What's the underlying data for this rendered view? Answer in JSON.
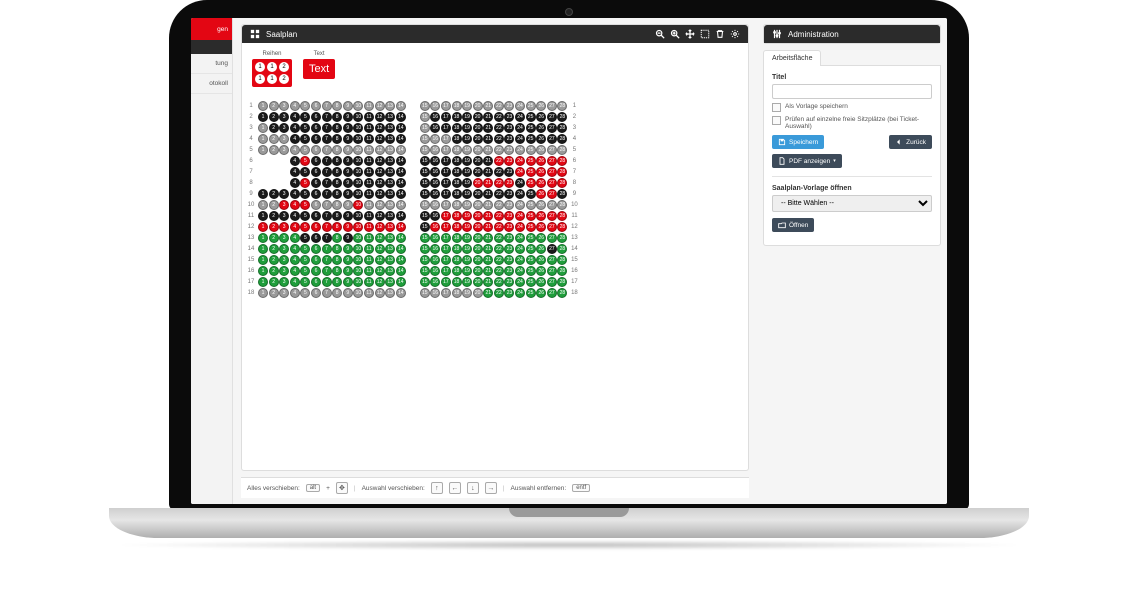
{
  "sidebar": {
    "top_red_fragment": "gen",
    "items": [
      "tung",
      "otokoll"
    ]
  },
  "main_panel": {
    "title": "Saalplan",
    "tools": [
      "zoom-out-icon",
      "zoom-in-icon",
      "move-icon",
      "select-icon",
      "delete-icon",
      "settings-icon"
    ]
  },
  "legend": {
    "reihen_label": "Reihen",
    "reihen_seats": [
      [
        1,
        1,
        2
      ],
      [
        1,
        1,
        2
      ]
    ],
    "text_label": "Text",
    "text_value": "Text"
  },
  "seating": {
    "rows": [
      {
        "n": 1,
        "left": "dddddddddddddd",
        "right": "dddddddddddddd"
      },
      {
        "n": 2,
        "left": "bbbbbbbbbbbbbb",
        "right": "dbbbbbbbbbbbbb"
      },
      {
        "n": 3,
        "left": "dbbbbbbbbbbbbb",
        "right": "dbbbbbbbbbbbbb"
      },
      {
        "n": 4,
        "left": "dddbbbbbbbbbbb",
        "right": "dddbbbbbbbbbbb"
      },
      {
        "n": 5,
        "left": "dddddddddddddd",
        "right": "dddddddddddddd"
      },
      {
        "n": 6,
        "left": "xxxbrbbbbbbbbb",
        "right": "bbbbbbbrrrrrrr"
      },
      {
        "n": 7,
        "left": "xxxbbbbbbbbbbb",
        "right": "bbbbbbbbbrrrrr"
      },
      {
        "n": 8,
        "left": "xxxbrbbbbbbbbb",
        "right": "bbbbbrrrrbrrrr"
      },
      {
        "n": 9,
        "left": "bbbbbbbbbbbbbb",
        "right": "bbbbbbbbbbbrrb"
      },
      {
        "n": 10,
        "left": "ddrrrddddrdddd",
        "right": "dddddddddddddd"
      },
      {
        "n": 11,
        "left": "bbbbbbbbbbbbbb",
        "right": "bbrrrrrrrrrrrr"
      },
      {
        "n": 12,
        "left": "rrrrrrrrrrrrrr",
        "right": "brrrrrrrrrrrrr"
      },
      {
        "n": 13,
        "left": "ggggbbbgbggggg",
        "right": "gggggggggggggg"
      },
      {
        "n": 14,
        "left": "gggggggggggggg",
        "right": "ggggggggggggbg"
      },
      {
        "n": 15,
        "left": "gggggggggggggg",
        "right": "gggggggggggggg"
      },
      {
        "n": 16,
        "left": "gggggggggggggg",
        "right": "gggggggggggggg"
      },
      {
        "n": 17,
        "left": "gggggggggggggg",
        "right": "gggggggggggggg"
      },
      {
        "n": 18,
        "left": "dddddddddddddd",
        "right": "ddddddgggggggg"
      }
    ]
  },
  "footer": {
    "move_all": "Alles verschieben:",
    "key_alt": "alt",
    "move_selection": "Auswahl verschieben:",
    "remove_selection": "Auswahl entfernen:",
    "key_entf": "entf"
  },
  "admin": {
    "title": "Administration",
    "tab": "Arbeitsfläche",
    "field_title_label": "Titel",
    "field_title_value": "",
    "chk_template": "Als Vorlage speichern",
    "chk_freeseats": "Prüfen auf einzelne freie Sitzplätze (bei Ticket-Auswahl)",
    "btn_save": "Speichern",
    "btn_back": "Zurück",
    "btn_pdf": "PDF anzeigen",
    "template_label": "Saalplan-Vorlage öffnen",
    "template_placeholder": "-- Bitte Wählen --",
    "btn_open": "Öffnen"
  }
}
